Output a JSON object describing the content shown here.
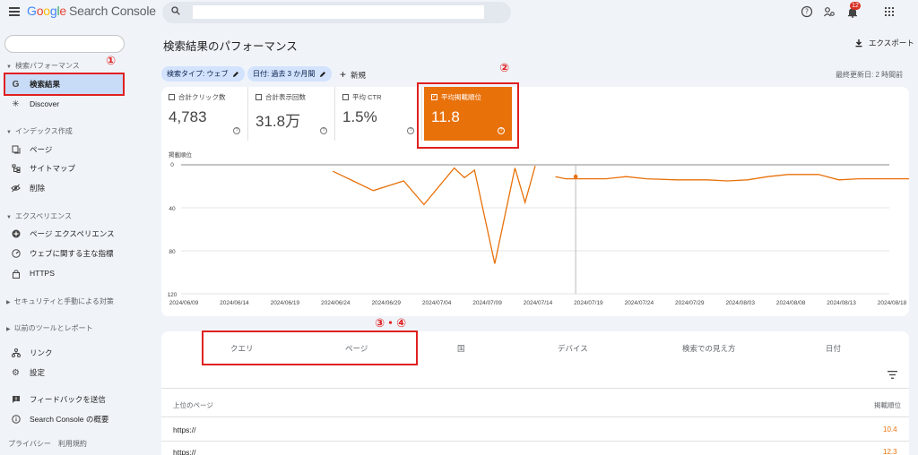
{
  "header": {
    "app_title": "Google Search Console",
    "logo_parts": [
      "G",
      "o",
      "o",
      "g",
      "l",
      "e"
    ],
    "product": "Search Console",
    "search_placeholder": "",
    "notification_count": "12"
  },
  "sidebar": {
    "property_value": "",
    "sections": [
      {
        "label": "検索パフォーマンス",
        "items": [
          {
            "label": "検索結果",
            "icon": "google-g-icon",
            "active": true
          },
          {
            "label": "Discover",
            "icon": "asterisk-icon"
          }
        ]
      },
      {
        "label": "インデックス作成",
        "items": [
          {
            "label": "ページ",
            "icon": "pages-icon"
          },
          {
            "label": "サイトマップ",
            "icon": "sitemap-icon"
          },
          {
            "label": "削除",
            "icon": "eye-off-icon"
          }
        ]
      },
      {
        "label": "エクスペリエンス",
        "items": [
          {
            "label": "ページ エクスペリエンス",
            "icon": "plus-circle-icon"
          },
          {
            "label": "ウェブに関する主な指標",
            "icon": "speedometer-icon"
          },
          {
            "label": "HTTPS",
            "icon": "lock-icon"
          }
        ]
      }
    ],
    "collapsed_sections": [
      "セキュリティと手動による対策",
      "以前のツールとレポート"
    ],
    "bottom_items": [
      {
        "label": "リンク",
        "icon": "links-icon"
      },
      {
        "label": "設定",
        "icon": "gear-icon"
      },
      {
        "label": "フィードバックを送信",
        "icon": "feedback-icon"
      },
      {
        "label": "Search Console の概要",
        "icon": "info-icon"
      }
    ],
    "footer": "プライバシー　利用規約"
  },
  "main": {
    "page_title": "検索結果のパフォーマンス",
    "export_label": "エクスポート",
    "filters": [
      "検索タイプ: ウェブ",
      "日付: 過去 3 か月間"
    ],
    "new_label": "新規",
    "last_updated": "最終更新日: 2 時間前",
    "metrics": [
      {
        "label": "合計クリック数",
        "value": "4,783",
        "checked": false
      },
      {
        "label": "合計表示回数",
        "value": "31.8万",
        "checked": false
      },
      {
        "label": "平均 CTR",
        "value": "1.5%",
        "checked": false
      },
      {
        "label": "平均掲載順位",
        "value": "11.8",
        "checked": true
      }
    ],
    "tabs": [
      "クエリ",
      "ページ",
      "国",
      "デバイス",
      "検索での見え方",
      "日付"
    ],
    "table": {
      "col_left": "上位のページ",
      "col_right": "掲載順位",
      "rows": [
        {
          "url": "https://",
          "value": "10.4"
        },
        {
          "url": "https://",
          "value": "12.3"
        }
      ]
    }
  },
  "annotations": [
    "①",
    "②",
    "③・④"
  ],
  "chart_data": {
    "type": "line",
    "ylabel": "掲載順位",
    "y_reversed": true,
    "ylim": [
      0,
      120
    ],
    "yticks": [
      "0",
      "40",
      "80",
      "120"
    ],
    "xticks": [
      "2024/06/09",
      "2024/06/14",
      "2024/06/19",
      "2024/06/24",
      "2024/06/29",
      "2024/07/04",
      "2024/07/09",
      "2024/07/14",
      "2024/07/19",
      "2024/07/24",
      "2024/07/29",
      "2024/08/03",
      "2024/08/08",
      "2024/08/13",
      "2024/08/18"
    ],
    "color": "#e8710a",
    "series": [
      {
        "segments": [
          [
            [
              15,
              6
            ],
            [
              17,
              15
            ],
            [
              19,
              24
            ],
            [
              22,
              15
            ],
            [
              24,
              37
            ],
            [
              27,
              3
            ],
            [
              28,
              12
            ],
            [
              29,
              5
            ],
            [
              31,
              92
            ],
            [
              33,
              3
            ],
            [
              34,
              35
            ],
            [
              35,
              1
            ]
          ],
          [
            [
              37,
              11
            ],
            [
              38,
              13
            ],
            [
              40,
              13
            ],
            [
              42,
              13
            ],
            [
              43,
              12
            ],
            [
              44,
              11
            ],
            [
              46,
              13
            ],
            [
              49,
              14
            ],
            [
              52,
              14
            ],
            [
              54,
              15
            ],
            [
              56,
              14
            ],
            [
              58,
              11
            ],
            [
              60,
              9
            ],
            [
              62,
              9
            ],
            [
              63,
              9
            ],
            [
              65,
              14
            ],
            [
              67,
              13
            ],
            [
              70,
              13
            ],
            [
              72,
              13
            ],
            [
              74,
              13
            ],
            [
              75,
              12
            ],
            [
              77,
              13
            ],
            [
              79,
              13
            ],
            [
              80,
              11
            ],
            [
              82,
              12
            ]
          ]
        ]
      }
    ],
    "x_start_index_date": "2024/06/09"
  }
}
